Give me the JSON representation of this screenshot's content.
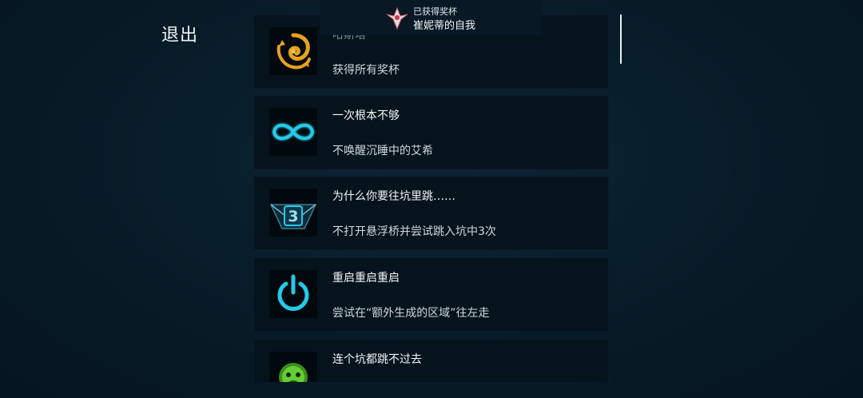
{
  "exit_label": "退出",
  "toast": {
    "label": "已获得奖杯",
    "name": "崔妮蒂的自我"
  },
  "achievements": [
    {
      "title": "哈斯塔",
      "desc": "获得所有奖杯",
      "icon": "golden-spiral-emblem-icon",
      "locked": true
    },
    {
      "title": "一次根本不够",
      "desc": "不唤醒沉睡中的艾希",
      "icon": "infinity-icon",
      "locked": false
    },
    {
      "title": "为什么你要往坑里跳……",
      "desc": "不打开悬浮桥并尝试跳入坑中3次",
      "icon": "pit-number-3-icon",
      "icon_text": "3",
      "locked": false
    },
    {
      "title": "重启重启重启",
      "desc": "尝试在“额外生成的区域”往左走",
      "icon": "power-icon",
      "locked": false
    },
    {
      "title": "连个坑都跳不过去",
      "desc": "",
      "icon": "green-monkey-face-icon",
      "locked": false
    }
  ],
  "colors": {
    "background": "#071a26",
    "card": "#05131d",
    "gold": "#e6a21f",
    "cyan": "#26c9e8",
    "green": "#6fe03a"
  }
}
